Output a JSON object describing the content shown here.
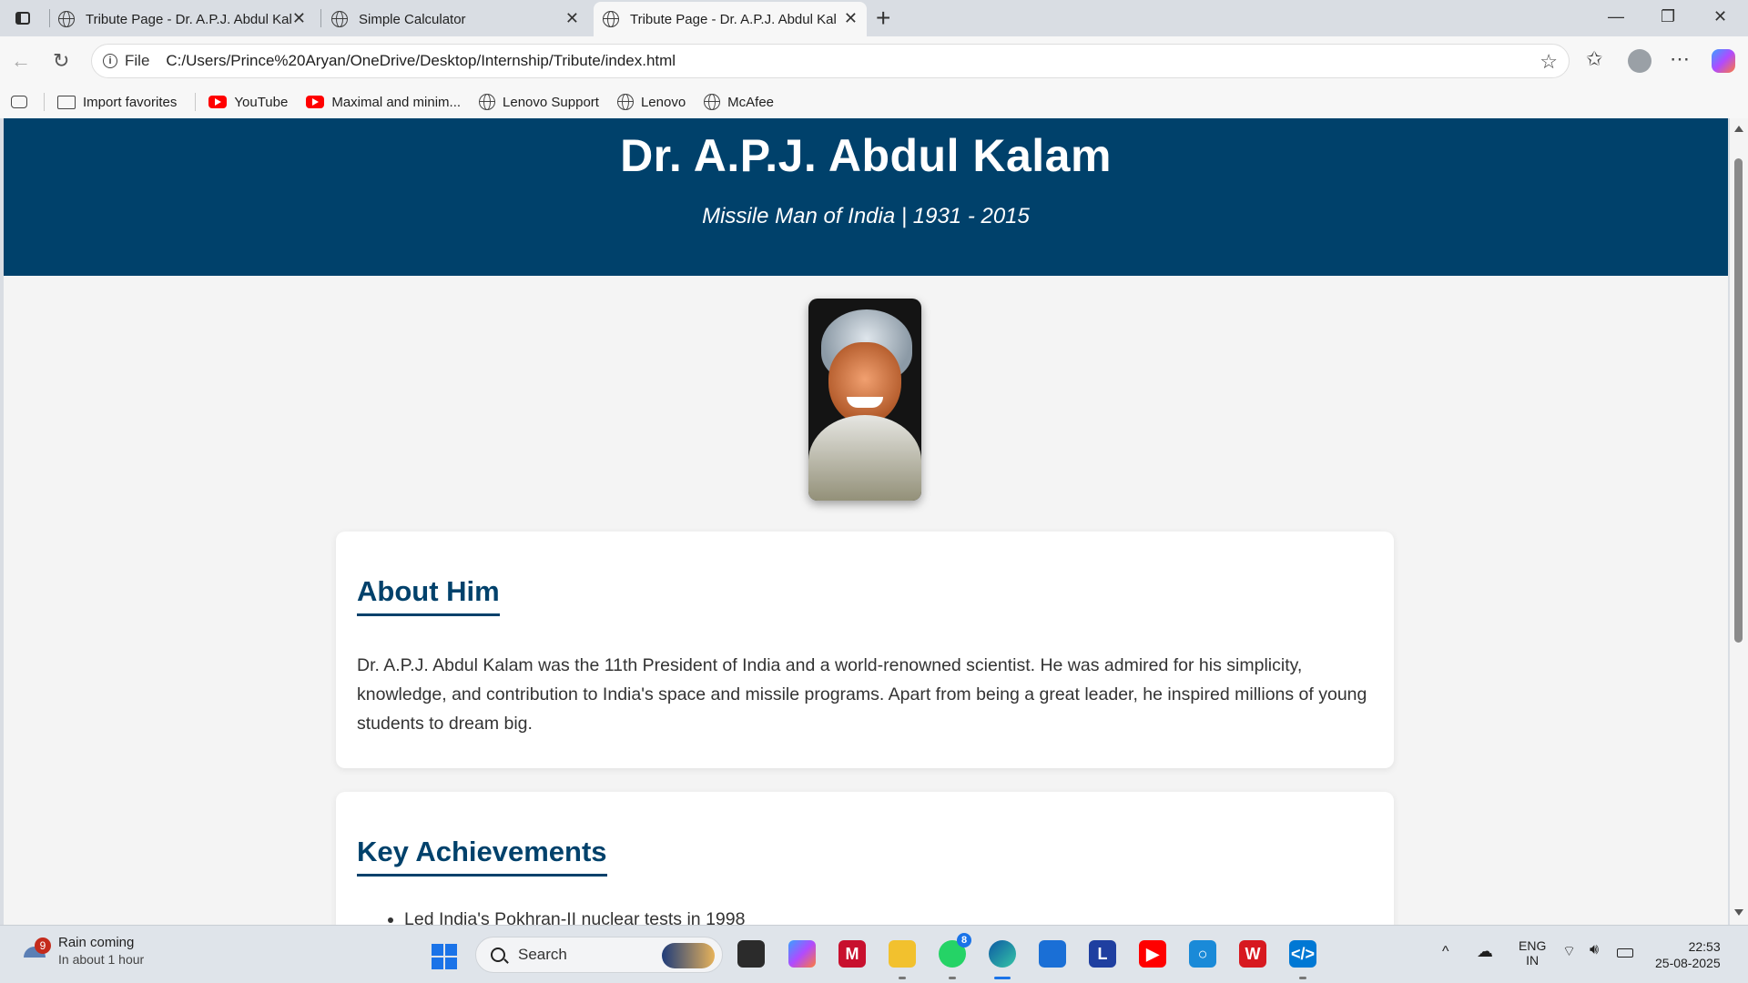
{
  "browser": {
    "tabs": [
      {
        "title": "Tribute Page - Dr. A.P.J. Abdul Kalam"
      },
      {
        "title": "Simple Calculator"
      },
      {
        "title": "Tribute Page - Dr. A.P.J. Abdul Kalam"
      }
    ],
    "address": {
      "scheme_chip": "File",
      "url": "C:/Users/Prince%20Aryan/OneDrive/Desktop/Internship/Tribute/index.html"
    },
    "favorites": [
      {
        "label": "Import favorites",
        "icon": "folder-icon"
      },
      {
        "label": "YouTube",
        "icon": "youtube-icon"
      },
      {
        "label": "Maximal and minim...",
        "icon": "youtube-icon"
      },
      {
        "label": "Lenovo Support",
        "icon": "globe-icon"
      },
      {
        "label": "Lenovo",
        "icon": "globe-icon"
      },
      {
        "label": "McAfee",
        "icon": "globe-icon"
      }
    ]
  },
  "page": {
    "header": {
      "title": "Dr. A.P.J. Abdul Kalam",
      "subtitle": "Missile Man of India | 1931 - 2015"
    },
    "about": {
      "heading": "About Him",
      "text": "Dr. A.P.J. Abdul Kalam was the 11th President of India and a world-renowned scientist. He was admired for his simplicity, knowledge, and contribution to India's space and missile programs. Apart from being a great leader, he inspired millions of young students to dream big."
    },
    "achievements": {
      "heading": "Key Achievements",
      "items": [
        "Led India's Pokhran-II nuclear tests in 1998"
      ]
    },
    "colors": {
      "header_bg": "#00416b",
      "accent": "#00416b"
    }
  },
  "taskbar": {
    "weather": {
      "badge": "9",
      "title": "Rain coming",
      "subtitle": "In about 1 hour"
    },
    "search_placeholder": "Search",
    "whatsapp_badge": "8",
    "lang_primary": "ENG",
    "lang_secondary": "IN",
    "time": "22:53",
    "date": "25-08-2025"
  }
}
